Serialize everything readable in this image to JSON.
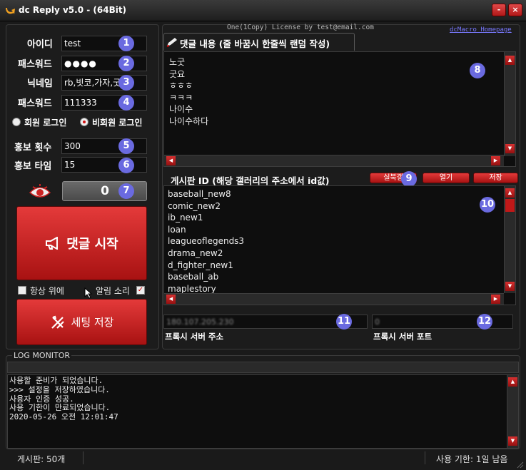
{
  "window": {
    "title": "dc Reply v5.0 - (64Bit)",
    "minimize": "-",
    "close": "×"
  },
  "login": {
    "id_label": "아이디",
    "id_value": "test",
    "pw_label": "패스워드",
    "pw_value": "●●●●",
    "nick_label": "닉네임",
    "nick_value": "rb,빗코,가자,굿,존",
    "pw2_label": "패스워드",
    "pw2_value": "111333",
    "member_radio": "회원 로그인",
    "guest_radio": "비회원 로그인"
  },
  "promo": {
    "count_label": "홍보 횟수",
    "count_value": "300",
    "time_label": "홍보 타임",
    "time_value": "15",
    "counter_value": "0"
  },
  "actions": {
    "start_label": "댓글 시작",
    "always_top": "항상 위에",
    "alarm_sound": "알림 소리",
    "save_settings": "세팅 저장"
  },
  "badges": [
    "1",
    "2",
    "3",
    "4",
    "5",
    "6",
    "7",
    "8",
    "9",
    "10",
    "11",
    "12"
  ],
  "header": {
    "license": "One(1Copy) License by test@email.com",
    "homepage_link": "dcMacro Homepage"
  },
  "comment": {
    "tab_label": "댓글 내용 (줄 바꿈시 한줄씩 랜덤 작성)",
    "lines": [
      "노굿",
      "굿요",
      "ㅎㅎㅎ",
      "ㅋㅋㅋ",
      "나이수",
      "나이수하다"
    ]
  },
  "board": {
    "label": "게시판 ID (해당 갤러리의 주소에서 id값)",
    "btn_realtime": "실북갤",
    "btn_open": "열기",
    "btn_save": "저장",
    "items": [
      "baseball_new8",
      "comic_new2",
      "ib_new1",
      "loan",
      "leagueoflegends3",
      "drama_new2",
      "d_fighter_new1",
      "baseball_ab",
      "maplestory"
    ]
  },
  "proxy": {
    "address_label": "프록시 서버 주소",
    "address_value": "180.107.205.230",
    "port_label": "프록시 서버 포트",
    "port_value": "0"
  },
  "log": {
    "title": "LOG MONITOR",
    "lines": [
      "사용할 준비가 되었습니다.",
      ">>> 설정을 저장하였습니다.",
      "사용자 인증 성공.",
      "사용 기한이 만료되었습니다.",
      "2020-05-26 오전 12:01:47"
    ]
  },
  "status": {
    "boards": "게시판: 50개",
    "expiry": "사용 기한: 1일 남음"
  },
  "colors": {
    "accent": "#c81e1e",
    "badge": "#6a6ae0",
    "background": "#1a1a1a"
  }
}
